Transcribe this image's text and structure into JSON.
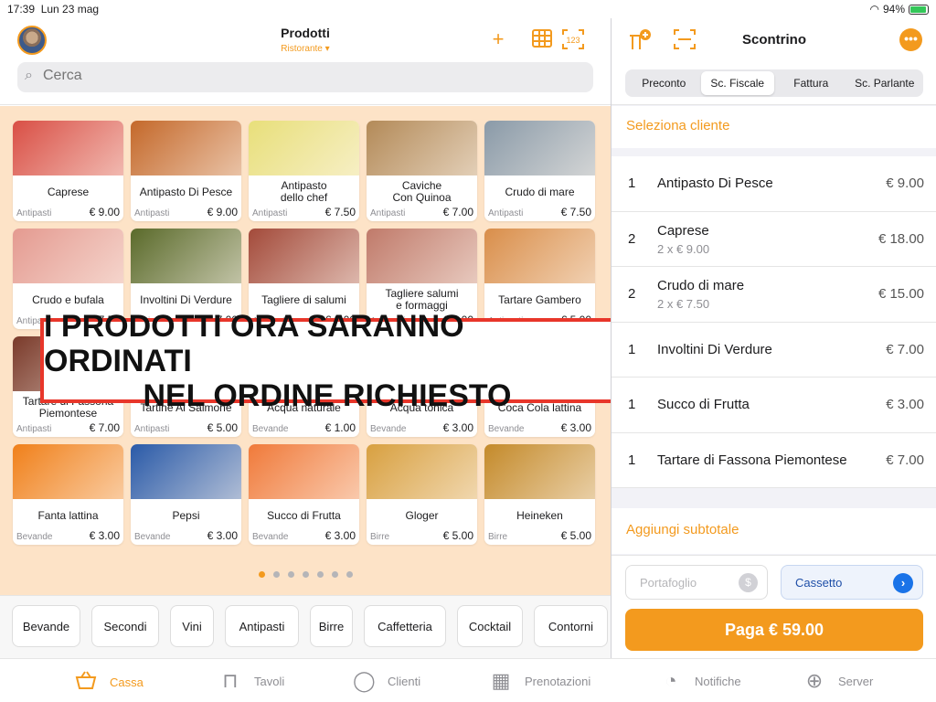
{
  "status": {
    "time": "17:39",
    "date": "Lun 23 mag",
    "battery": "94%"
  },
  "header": {
    "title": "Prodotti",
    "subtitle": "Ristorante",
    "search_placeholder": "Cerca"
  },
  "products": [
    {
      "name": "Caprese",
      "category": "Antipasti",
      "price": "€ 9.00",
      "color": "#d94f45"
    },
    {
      "name": "Antipasto Di Pesce",
      "category": "Antipasti",
      "price": "€ 9.00",
      "color": "#c4682a"
    },
    {
      "name": "Antipasto\ndello chef",
      "category": "Antipasti",
      "price": "€ 7.50",
      "color": "#e8df7a"
    },
    {
      "name": "Caviche\nCon Quinoa",
      "category": "Antipasti",
      "price": "€ 7.00",
      "color": "#b38a58"
    },
    {
      "name": "Crudo di mare",
      "category": "Antipasti",
      "price": "€ 7.50",
      "color": "#8a9aa8"
    },
    {
      "name": "Crudo e bufala",
      "category": "Antipasti",
      "price": "€ 7.50",
      "color": "#e49a90"
    },
    {
      "name": "Involtini Di Verdure",
      "category": "Antipasti",
      "price": "€ 7.00",
      "color": "#5a6a2a"
    },
    {
      "name": "Tagliere di salumi",
      "category": "Antipasti",
      "price": "€ 8.00",
      "color": "#a34a3a"
    },
    {
      "name": "Tagliere salumi\ne formaggi",
      "category": "Antipasti",
      "price": "€ 9.00",
      "color": "#c07a6a"
    },
    {
      "name": "Tartare Gambero",
      "category": "Antipasti",
      "price": "€ 5.00",
      "color": "#d98e4a"
    },
    {
      "name": "Tartare di Fassona\nPiemontese",
      "category": "Antipasti",
      "price": "€ 7.00",
      "color": "#7a3a2a"
    },
    {
      "name": "Tartine Al Salmone",
      "category": "Antipasti",
      "price": "€ 5.00",
      "color": "#e09a6a"
    },
    {
      "name": "Acqua naturale",
      "category": "Bevande",
      "price": "€ 1.00",
      "color": "#7ab4d8"
    },
    {
      "name": "Acqua tonica",
      "category": "Bevande",
      "price": "€ 3.00",
      "color": "#9ad0b8"
    },
    {
      "name": "Coca Cola lattina",
      "category": "Bevande",
      "price": "€ 3.00",
      "color": "#c0302a"
    },
    {
      "name": "Fanta lattina",
      "category": "Bevande",
      "price": "€ 3.00",
      "color": "#f0801a"
    },
    {
      "name": "Pepsi",
      "category": "Bevande",
      "price": "€ 3.00",
      "color": "#2a5aa8"
    },
    {
      "name": "Succo di Frutta",
      "category": "Bevande",
      "price": "€ 3.00",
      "color": "#f07a3a"
    },
    {
      "name": "Gloger",
      "category": "Birre",
      "price": "€ 5.00",
      "color": "#d8a040"
    },
    {
      "name": "Heineken",
      "category": "Birre",
      "price": "€ 5.00",
      "color": "#c48a2a"
    }
  ],
  "overlay": {
    "line1": "I PRODOTTI ORA SARANNO ORDINATI",
    "line2": "NEL ORDINE RICHIESTO"
  },
  "categories": [
    "Bevande",
    "Secondi",
    "Vini",
    "Antipasti",
    "Birre",
    "Caffetteria",
    "Cocktail",
    "Contorni"
  ],
  "receipt": {
    "title": "Scontrino",
    "segments": [
      "Preconto",
      "Sc. Fiscale",
      "Fattura",
      "Sc. Parlante"
    ],
    "active_segment": 1,
    "select_client": "Seleziona cliente",
    "lines": [
      {
        "qty": "1",
        "name": "Antipasto Di Pesce",
        "detail": "",
        "price": "€ 9.00"
      },
      {
        "qty": "2",
        "name": "Caprese",
        "detail": "2 x € 9.00",
        "price": "€ 18.00"
      },
      {
        "qty": "2",
        "name": "Crudo di mare",
        "detail": "2 x € 7.50",
        "price": "€ 15.00"
      },
      {
        "qty": "1",
        "name": "Involtini Di Verdure",
        "detail": "",
        "price": "€ 7.00"
      },
      {
        "qty": "1",
        "name": "Succo di Frutta",
        "detail": "",
        "price": "€ 3.00"
      },
      {
        "qty": "1",
        "name": "Tartare di Fassona Piemontese",
        "detail": "",
        "price": "€ 7.00"
      }
    ],
    "add_subtotal": "Aggiungi subtotale",
    "wallet": "Portafoglio",
    "drawer": "Cassetto",
    "pay": "Paga € 59.00"
  },
  "tabs": [
    {
      "label": "Cassa",
      "icon": "basket-icon",
      "active": true
    },
    {
      "label": "Tavoli",
      "icon": "table-icon",
      "active": false
    },
    {
      "label": "Clienti",
      "icon": "person-icon",
      "active": false
    },
    {
      "label": "Prenotazioni",
      "icon": "calendar-icon",
      "active": false
    },
    {
      "label": "Notifiche",
      "icon": "bell-icon",
      "active": false
    },
    {
      "label": "Server",
      "icon": "globe-icon",
      "active": false
    }
  ],
  "pager": {
    "pages": 7,
    "current": 1
  }
}
